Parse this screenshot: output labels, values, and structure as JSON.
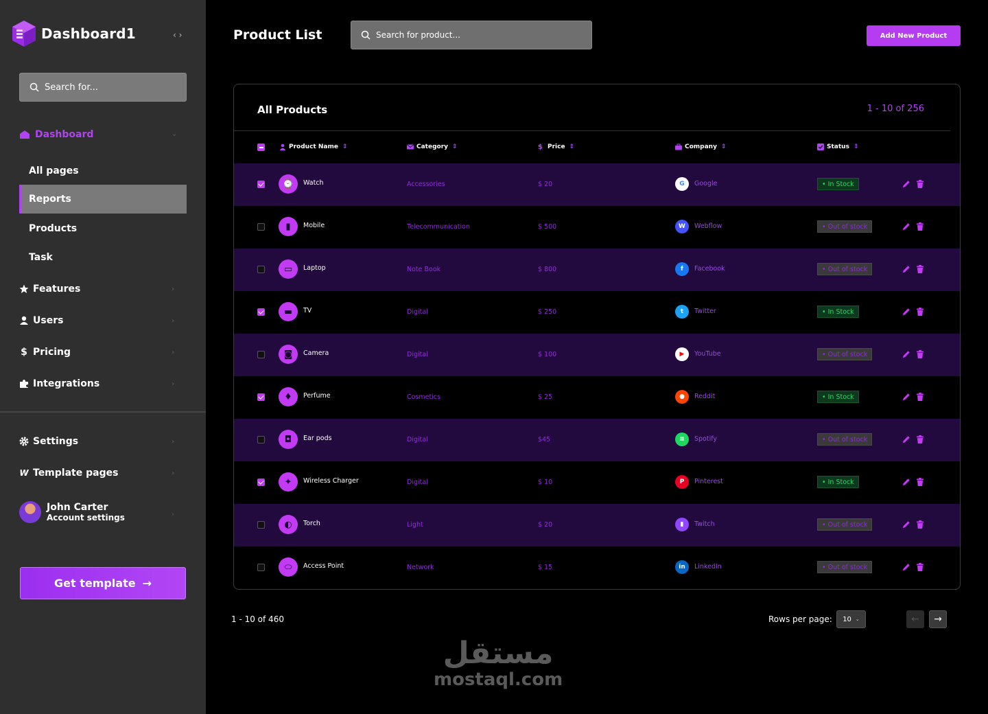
{
  "brand": {
    "name": "Dashboard1"
  },
  "sidebar": {
    "search_placeholder": "Search for...",
    "dashboard_label": "Dashboard",
    "sub_items": [
      {
        "label": "All pages"
      },
      {
        "label": "Reports",
        "active": true
      },
      {
        "label": "Products"
      },
      {
        "label": "Task"
      }
    ],
    "nav_items": [
      {
        "label": "Features",
        "icon": "star-icon"
      },
      {
        "label": "Users",
        "icon": "user-icon"
      },
      {
        "label": "Pricing",
        "icon": "dollar-icon"
      },
      {
        "label": "Integrations",
        "icon": "puzzle-icon"
      }
    ],
    "bottom_items": [
      {
        "label": "Settings",
        "icon": "gear-icon"
      },
      {
        "label": "Template pages",
        "icon": "webflow-icon"
      }
    ],
    "profile": {
      "name": "John Carter",
      "subtitle": "Account settings"
    },
    "cta_label": "Get template"
  },
  "header": {
    "title": "Product List",
    "search_placeholder": "Search for product...",
    "add_button": "Add New Product"
  },
  "panel": {
    "title": "All Products",
    "count": "1 - 10 of 256",
    "columns": [
      "Product Name",
      "Category",
      "Price",
      "Company",
      "Status"
    ]
  },
  "products": [
    {
      "name": "Watch",
      "category": "Accessories",
      "price": "$ 20",
      "company": "Google",
      "company_color": "#ffffff",
      "status": "In Stock",
      "in_stock": true,
      "checked": true
    },
    {
      "name": "Mobile",
      "category": "Telecommunication",
      "price": "$ 500",
      "company": "Webflow",
      "company_color": "#4353ff",
      "status": "Out of stock",
      "in_stock": false,
      "checked": false
    },
    {
      "name": "Laptop",
      "category": "Note Book",
      "price": "$ 800",
      "company": "Facebook",
      "company_color": "#1877f2",
      "status": "Out of stock",
      "in_stock": false,
      "checked": false
    },
    {
      "name": "TV",
      "category": "Digital",
      "price": "$ 250",
      "company": "Twitter",
      "company_color": "#1da1f2",
      "status": "In Stock",
      "in_stock": true,
      "checked": true
    },
    {
      "name": "Camera",
      "category": "Digital",
      "price": "$ 100",
      "company": "YouTube",
      "company_color": "#ffffff",
      "status": "Out of stock",
      "in_stock": false,
      "checked": false
    },
    {
      "name": "Perfume",
      "category": "Cosmetics",
      "price": "$ 25",
      "company": "Reddit",
      "company_color": "#ff4500",
      "status": "In Stock",
      "in_stock": true,
      "checked": true
    },
    {
      "name": "Ear pods",
      "category": "Digital",
      "price": "$45",
      "company": "Spotify",
      "company_color": "#1ed760",
      "status": "Out of stock",
      "in_stock": false,
      "checked": false
    },
    {
      "name": "Wireless Charger",
      "category": "Digital",
      "price": "$ 10",
      "company": "Pinterest",
      "company_color": "#e60023",
      "status": "In Stock",
      "in_stock": true,
      "checked": true
    },
    {
      "name": "Torch",
      "category": "Light",
      "price": "$ 20",
      "company": "Twitch",
      "company_color": "#9146ff",
      "status": "Out of stock",
      "in_stock": false,
      "checked": false
    },
    {
      "name": "Access Point",
      "category": "Network",
      "price": "$ 15",
      "company": "LinkedIn",
      "company_color": "#0a66c2",
      "status": "Out of stock",
      "in_stock": false,
      "checked": false
    }
  ],
  "footer": {
    "range": "1 - 10 of 460",
    "rows_label": "Rows per page:",
    "rows_value": "10"
  },
  "watermark": {
    "arabic": "مستقل",
    "latin": "mostaql.com"
  },
  "colors": {
    "accent": "#b044f2",
    "row_alt": "#220a3e",
    "in_stock": "#2fd468"
  }
}
